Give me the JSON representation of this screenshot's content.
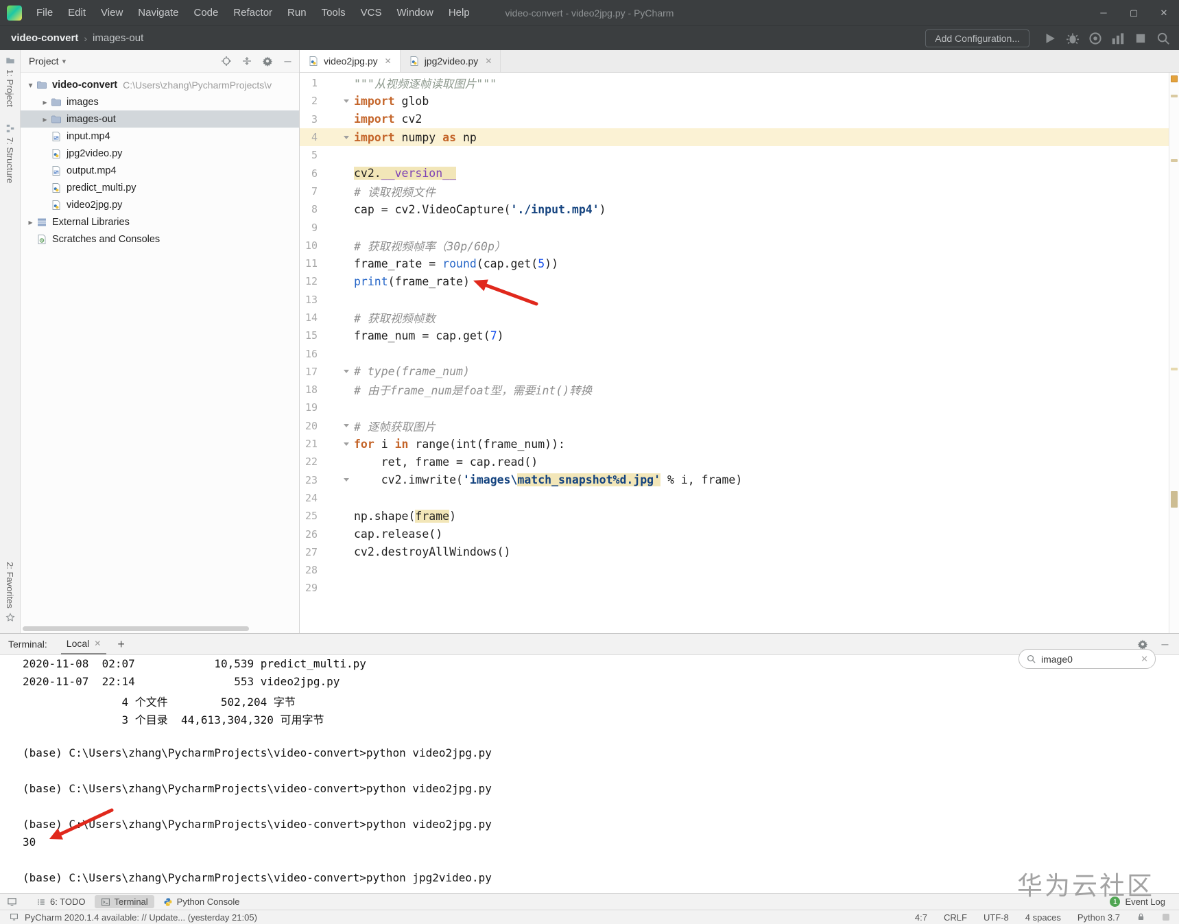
{
  "title_bar": {
    "title": "video-convert - video2jpg.py - PyCharm",
    "menus": [
      "File",
      "Edit",
      "View",
      "Navigate",
      "Code",
      "Refactor",
      "Run",
      "Tools",
      "VCS",
      "Window",
      "Help"
    ],
    "window_controls": [
      "minimize-icon",
      "maximize-icon",
      "close-icon"
    ]
  },
  "run_toolbar": {
    "project_crumb": "video-convert",
    "crumb_separator": "›",
    "folder_crumb": "images-out",
    "add_configuration_label": "Add Configuration...",
    "action_icons": [
      "run-icon",
      "debug-icon",
      "coverage-icon",
      "profiler-icon",
      "stop-icon",
      "search-icon"
    ]
  },
  "tool_stripe": {
    "top_items": [
      {
        "label": "1: Project",
        "icon": "project-stripe-icon"
      },
      {
        "label": "7: Structure",
        "icon": "structure-stripe-icon"
      }
    ],
    "bottom_items": [
      {
        "label": "2: Favorites",
        "icon": "favorites-stripe-icon"
      }
    ]
  },
  "project_panel": {
    "title": "Project",
    "header_icons": [
      "locate-icon",
      "collapse-all-icon",
      "gear-icon",
      "hide-panel-icon"
    ],
    "tree": [
      {
        "label": "video-convert",
        "path": "C:\\Users\\zhang\\PycharmProjects\\v",
        "icon": "folder-icon",
        "indent": 0,
        "arrow": "down",
        "bold": true
      },
      {
        "label": "images",
        "icon": "folder-icon",
        "indent": 1,
        "arrow": "right"
      },
      {
        "label": "images-out",
        "icon": "folder-icon",
        "indent": 1,
        "arrow": "right",
        "selected": true
      },
      {
        "label": "input.mp4",
        "icon": "mp4-icon",
        "indent": 1
      },
      {
        "label": "jpg2video.py",
        "icon": "py-icon",
        "indent": 1
      },
      {
        "label": "output.mp4",
        "icon": "mp4-icon",
        "indent": 1
      },
      {
        "label": "predict_multi.py",
        "icon": "py-icon",
        "indent": 1
      },
      {
        "label": "video2jpg.py",
        "icon": "py-icon",
        "indent": 1
      },
      {
        "label": "External Libraries",
        "icon": "lib-icon",
        "indent": 0,
        "arrow": "right"
      },
      {
        "label": "Scratches and Consoles",
        "icon": "scratch-icon",
        "indent": 0
      }
    ]
  },
  "editor": {
    "tabs": [
      {
        "label": "video2jpg.py",
        "active": true
      },
      {
        "label": "jpg2video.py",
        "active": false
      }
    ],
    "lines": [
      {
        "n": 1,
        "segs": [
          [
            "doc",
            "\"\"\"从视频逐帧读取图片\"\"\""
          ]
        ]
      },
      {
        "n": 2,
        "fold": true,
        "segs": [
          [
            "kw",
            "import"
          ],
          [
            "pl",
            " glob"
          ]
        ]
      },
      {
        "n": 3,
        "segs": [
          [
            "kw",
            "import"
          ],
          [
            "pl",
            " cv2"
          ]
        ]
      },
      {
        "n": 4,
        "caret": true,
        "fold": true,
        "segs": [
          [
            "kw",
            "import"
          ],
          [
            "pl",
            " numpy "
          ],
          [
            "kw",
            "as"
          ],
          [
            "pl",
            " np"
          ]
        ]
      },
      {
        "n": 5,
        "segs": []
      },
      {
        "n": 6,
        "segs": [
          [
            "pl hl",
            "cv2."
          ],
          [
            "pur hl",
            "__version__"
          ]
        ]
      },
      {
        "n": 7,
        "segs": [
          [
            "cm",
            "# 读取视频文件"
          ]
        ]
      },
      {
        "n": 8,
        "segs": [
          [
            "pl",
            "cap = cv2.VideoCapture("
          ],
          [
            "str",
            "'./input.mp4'"
          ],
          [
            "pl",
            ")"
          ]
        ]
      },
      {
        "n": 9,
        "segs": []
      },
      {
        "n": 10,
        "segs": [
          [
            "cm",
            "# 获取视频帧率（30p/60p）"
          ]
        ]
      },
      {
        "n": 11,
        "segs": [
          [
            "pl",
            "frame_rate = "
          ],
          [
            "fn",
            "round"
          ],
          [
            "pl",
            "(cap.get("
          ],
          [
            "num",
            "5"
          ],
          [
            "pl",
            "))"
          ]
        ]
      },
      {
        "n": 12,
        "segs": [
          [
            "fn",
            "print"
          ],
          [
            "pl",
            "(frame_rate)"
          ]
        ]
      },
      {
        "n": 13,
        "segs": []
      },
      {
        "n": 14,
        "segs": [
          [
            "cm",
            "# 获取视频帧数"
          ]
        ]
      },
      {
        "n": 15,
        "segs": [
          [
            "pl",
            "frame_num = cap.get("
          ],
          [
            "num",
            "7"
          ],
          [
            "pl",
            ")"
          ]
        ]
      },
      {
        "n": 16,
        "segs": []
      },
      {
        "n": 17,
        "fold": true,
        "segs": [
          [
            "cm",
            "# type(frame_num)"
          ]
        ]
      },
      {
        "n": 18,
        "segs": [
          [
            "cm",
            "# 由于frame_num是foat型，需要int()转换"
          ]
        ]
      },
      {
        "n": 19,
        "segs": []
      },
      {
        "n": 20,
        "fold": true,
        "segs": [
          [
            "cm",
            "# 逐帧获取图片"
          ]
        ]
      },
      {
        "n": 21,
        "fold": true,
        "segs": [
          [
            "kw",
            "for"
          ],
          [
            "pl",
            " i "
          ],
          [
            "kw",
            "in"
          ],
          [
            "pl",
            " range(int(frame_num)):"
          ]
        ]
      },
      {
        "n": 22,
        "segs": [
          [
            "pl",
            "    ret, frame = cap.read()"
          ]
        ]
      },
      {
        "n": 23,
        "fold": true,
        "segs": [
          [
            "pl",
            "    cv2.imwrite("
          ],
          [
            "str",
            "'images\\"
          ],
          [
            "str hl",
            "match_snapshot%d.jpg'"
          ],
          [
            "pl",
            " % i, frame)"
          ]
        ]
      },
      {
        "n": 24,
        "segs": []
      },
      {
        "n": 25,
        "segs": [
          [
            "pl",
            "np.shape("
          ],
          [
            "pl hl",
            "frame"
          ],
          [
            "pl",
            ")"
          ]
        ]
      },
      {
        "n": 26,
        "segs": [
          [
            "pl",
            "cap.release()"
          ]
        ]
      },
      {
        "n": 27,
        "segs": [
          [
            "pl",
            "cv2.destroyAllWindows()"
          ]
        ]
      },
      {
        "n": 28,
        "segs": []
      },
      {
        "n": 29,
        "segs": []
      }
    ]
  },
  "terminal": {
    "panel_label": "Terminal:",
    "tab_label": "Local",
    "header_icons": [
      "gear-icon",
      "minimize-icon"
    ],
    "search_value": "image0",
    "lines": [
      "2020-11-08  02:07            10,539 predict_multi.py",
      "2020-11-07  22:14               553 video2jpg.py",
      "               4 个文件        502,204 字节",
      "               3 个目录  44,613,304,320 可用字节",
      "",
      "(base) C:\\Users\\zhang\\PycharmProjects\\video-convert>python video2jpg.py",
      "",
      "(base) C:\\Users\\zhang\\PycharmProjects\\video-convert>python video2jpg.py",
      "",
      "(base) C:\\Users\\zhang\\PycharmProjects\\video-convert>python video2jpg.py",
      "30",
      "",
      "(base) C:\\Users\\zhang\\PycharmProjects\\video-convert>python jpg2video.py"
    ]
  },
  "bottom_bar": {
    "left_items": [
      {
        "label": "6: TODO",
        "icon": "todo-icon"
      },
      {
        "label": "Terminal",
        "icon": "terminal-icon",
        "active": true
      },
      {
        "label": "Python Console",
        "icon": "python-icon"
      }
    ],
    "event_log_label": "Event Log",
    "event_log_badge": "1"
  },
  "status_bar": {
    "message": "PyCharm 2020.1.4 available: // Update... (yesterday 21:05)",
    "right_items": [
      "4:7",
      "CRLF",
      "UTF-8",
      "4 spaces",
      "Python 3.7"
    ]
  },
  "watermark": "华为云社区",
  "colors": {
    "selection": "#d2d7db",
    "caret_line": "#fbf2d4",
    "arrow_red": "#e0281c",
    "event_badge_green": "#50a653",
    "inspection_orange": "#e3a23c"
  }
}
